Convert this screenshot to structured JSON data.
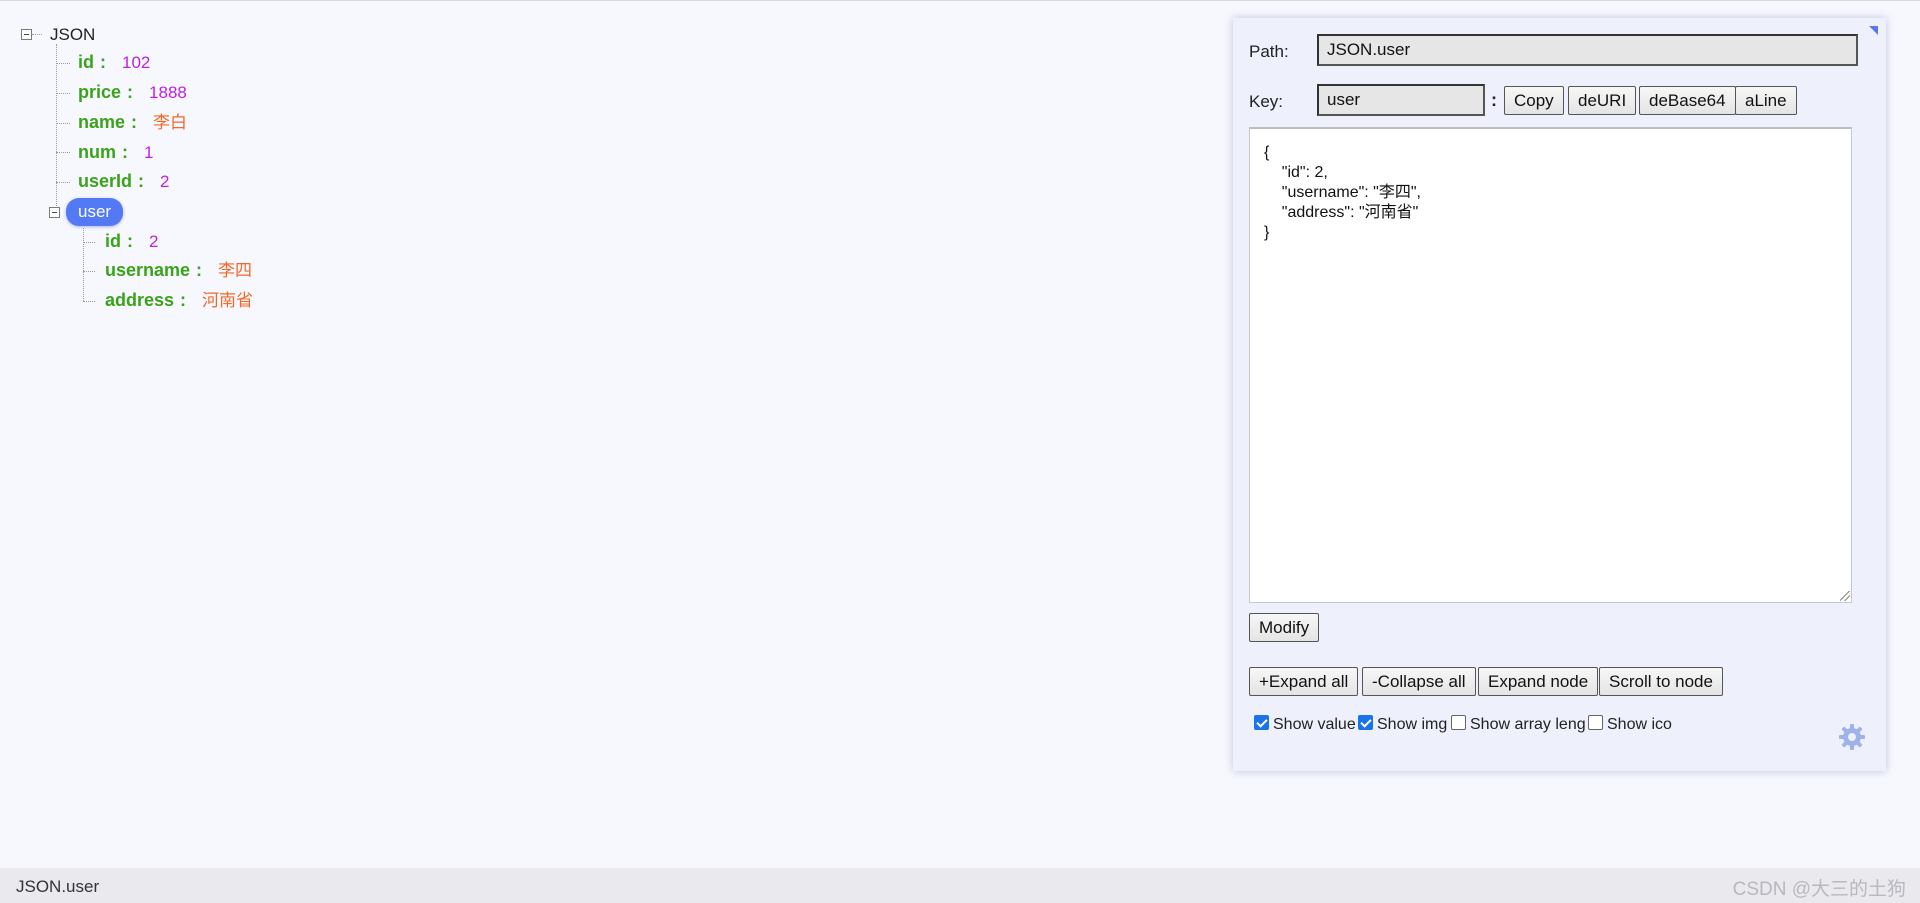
{
  "tree": {
    "root_label": "JSON",
    "items": [
      {
        "key": "id",
        "value": "102",
        "type": "number"
      },
      {
        "key": "price",
        "value": "1888",
        "type": "number"
      },
      {
        "key": "name",
        "value": "李白",
        "type": "string"
      },
      {
        "key": "num",
        "value": "1",
        "type": "number"
      },
      {
        "key": "userId",
        "value": "2",
        "type": "number"
      }
    ],
    "selected_node": "user",
    "children": [
      {
        "key": "id",
        "value": "2",
        "type": "number"
      },
      {
        "key": "username",
        "value": "李四",
        "type": "string"
      },
      {
        "key": "address",
        "value": "河南省",
        "type": "string"
      }
    ],
    "colon": ":",
    "colors": {
      "key": "#3aa31a",
      "number": "#c020e0",
      "string": "#ee6a2a",
      "selected": "#5379f5"
    }
  },
  "panel": {
    "path_label": "Path:",
    "path_value": "JSON.user",
    "key_label": "Key:",
    "key_value": "user",
    "key_colon": ":",
    "buttons": {
      "copy": "Copy",
      "deuri": "deURI",
      "debase64": "deBase64",
      "aline": "aLine",
      "modify": "Modify",
      "expand_all": "+Expand all",
      "collapse_all": "-Collapse all",
      "expand_node": "Expand node",
      "scroll_to_node": "Scroll to node"
    },
    "editor_text": "{\n    \"id\": 2,\n    \"username\": \"李四\",\n    \"address\": \"河南省\"\n}",
    "options": [
      {
        "label": "Show value",
        "checked": true
      },
      {
        "label": "Show img",
        "checked": true
      },
      {
        "label": "Show array leng",
        "checked": false
      },
      {
        "label": "Show ico",
        "checked": false
      }
    ],
    "settings_icon": "gear-icon"
  },
  "status_bar": {
    "path": "JSON.user",
    "watermark": "CSDN @大三的土狗"
  }
}
